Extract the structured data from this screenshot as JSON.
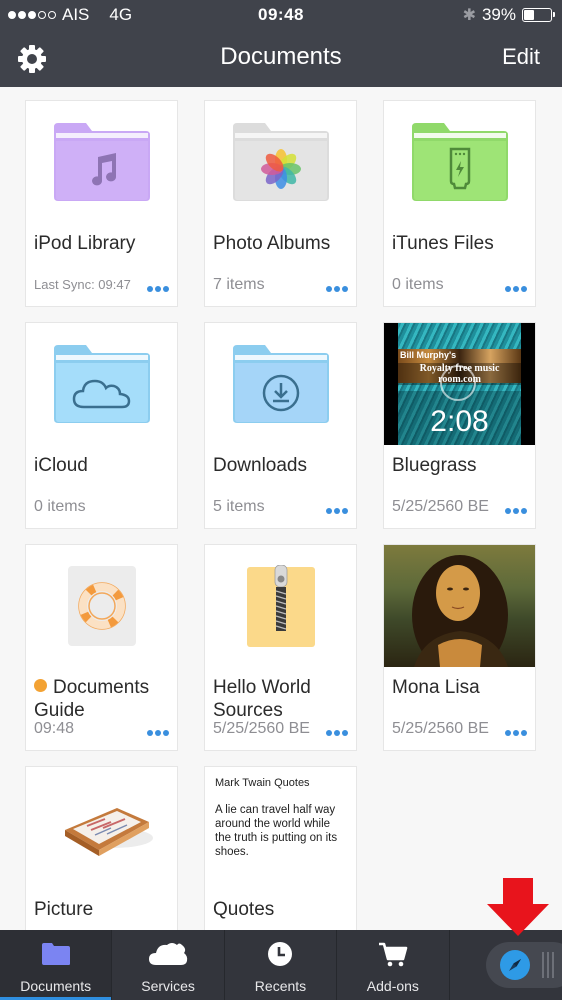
{
  "status_bar": {
    "carrier": "AIS",
    "network": "4G",
    "signal_bars_filled": 3,
    "signal_bars_total": 5,
    "time": "09:48",
    "battery_percent_label": "39%",
    "battery_level": 0.39
  },
  "nav": {
    "title": "Documents",
    "edit_label": "Edit",
    "settings_icon": "gear-icon"
  },
  "items": [
    {
      "name": "iPod Library",
      "meta": "Last Sync: 09:47",
      "type": "folder",
      "icon": "music-note-icon",
      "color": "#c9a8f5",
      "has_more": true
    },
    {
      "name": "Photo Albums",
      "meta": "7 items",
      "type": "folder",
      "icon": "photos-flower-icon",
      "color": "#e3e3e3",
      "has_more": true
    },
    {
      "name": "iTunes Files",
      "meta": "0 items",
      "type": "folder",
      "icon": "usb-connector-icon",
      "color": "#9ee476",
      "has_more": true
    },
    {
      "name": "iCloud",
      "meta": "0 items",
      "type": "folder",
      "icon": "cloud-icon",
      "color": "#a5ddfa",
      "has_more": false
    },
    {
      "name": "Downloads",
      "meta": "5 items",
      "type": "folder",
      "icon": "download-icon",
      "color": "#a5d5f8",
      "has_more": true
    },
    {
      "name": "Bluegrass",
      "meta": "5/25/2560 BE",
      "type": "video",
      "duration": "2:08",
      "thumb_caption_1": "Bill Murphy's",
      "thumb_caption_2": "Royalty free music room.com",
      "has_more": true
    },
    {
      "name": "Documents Guide",
      "meta": "09:48",
      "type": "guide",
      "icon": "lifebuoy-icon",
      "badge_color": "#f3a233",
      "has_more": true
    },
    {
      "name": "Hello World Sources",
      "meta": "5/25/2560 BE",
      "type": "archive",
      "icon": "zip-icon",
      "has_more": true
    },
    {
      "name": "Mona Lisa",
      "meta": "5/25/2560 BE",
      "type": "image",
      "icon": "painting-thumbnail",
      "has_more": true
    },
    {
      "name": "Picture",
      "type": "image",
      "icon": "photo-tray-icon"
    },
    {
      "name": "Quotes",
      "type": "text",
      "preview_title": "Mark Twain Quotes",
      "preview_body": "A lie can travel half way around the world while the truth is putting on its shoes."
    }
  ],
  "tabs": [
    {
      "label": "Documents",
      "icon": "folder-icon",
      "active": true
    },
    {
      "label": "Services",
      "icon": "cloud-icon",
      "active": false
    },
    {
      "label": "Recents",
      "icon": "clock-icon",
      "active": false
    },
    {
      "label": "Add-ons",
      "icon": "cart-icon",
      "active": false
    }
  ],
  "browser_pill": {
    "icon": "compass-icon"
  },
  "annotation": {
    "type": "red-arrow",
    "color": "#e8141c"
  },
  "colors": {
    "bar": "#40434b",
    "tabbar": "#33353c",
    "accent": "#2f8fe0",
    "more_dots": "#3a8fde"
  }
}
